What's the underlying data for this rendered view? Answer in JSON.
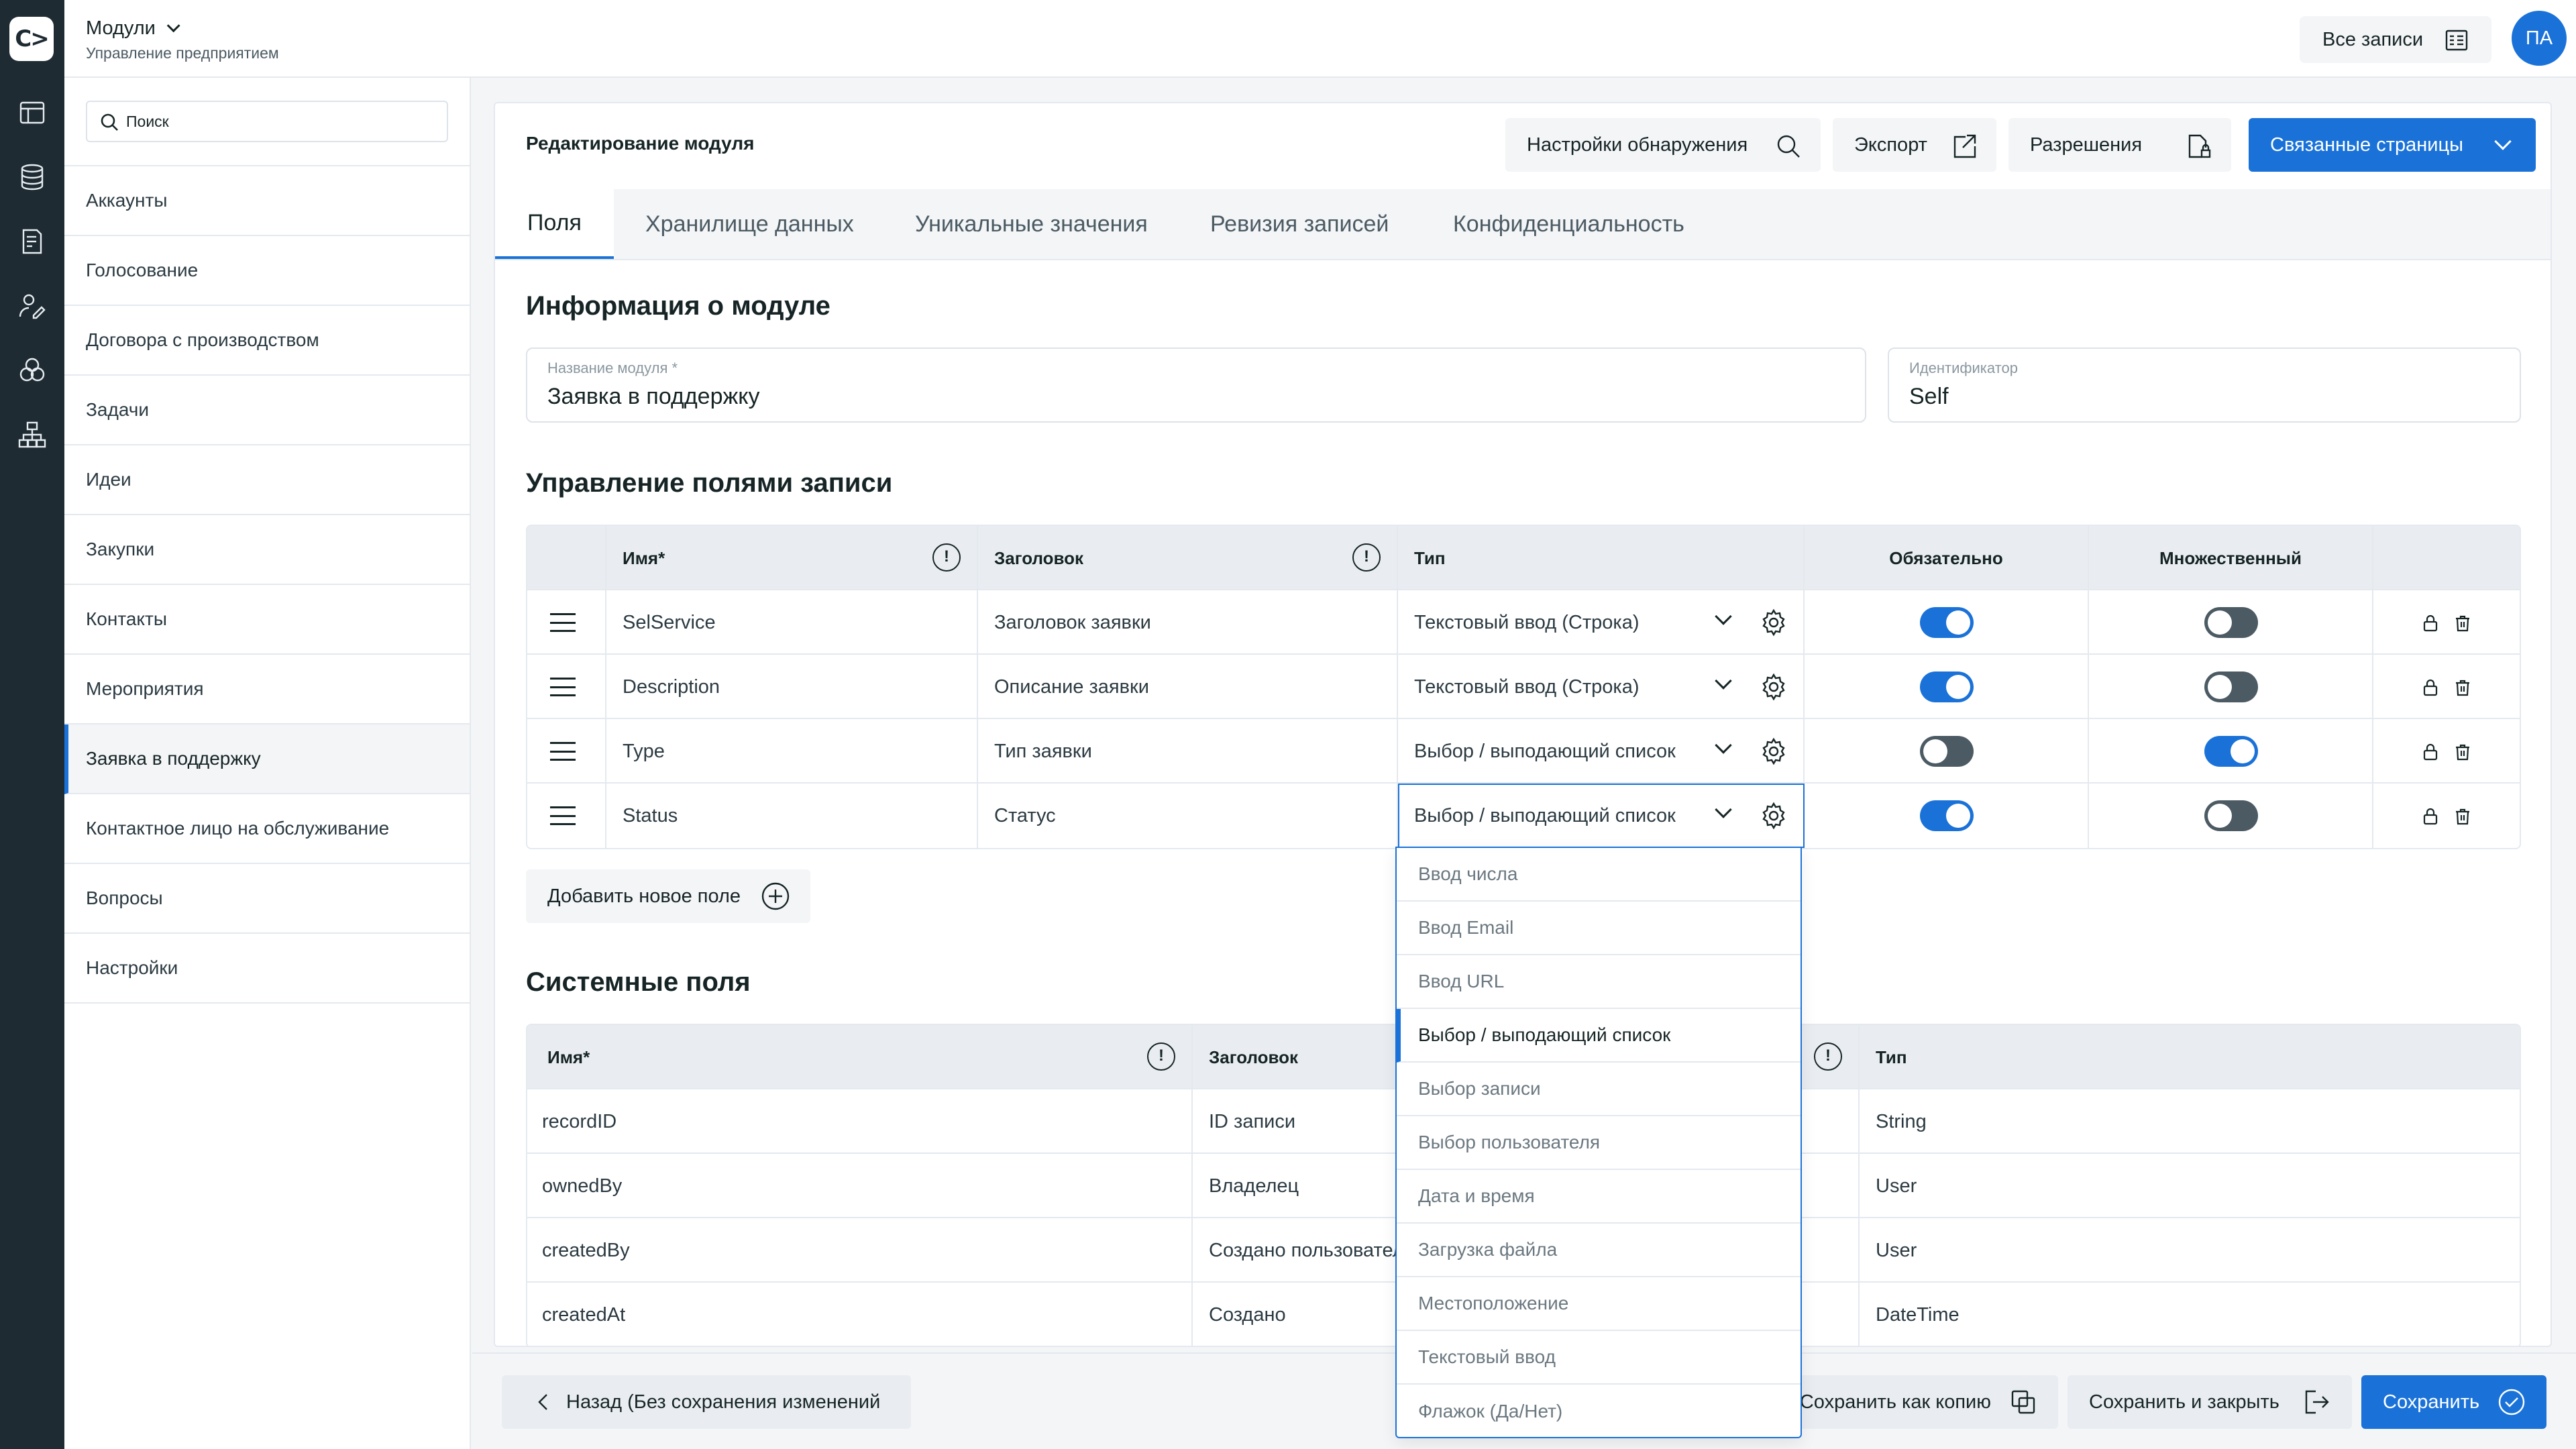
{
  "header": {
    "title": "Модули",
    "subtitle": "Управление предприятием",
    "all_records": "Все записи",
    "avatar": "ПА"
  },
  "sidebar": {
    "search_placeholder": "Поиск",
    "items": [
      {
        "label": "Аккаунты"
      },
      {
        "label": "Голосование"
      },
      {
        "label": "Договора с производством"
      },
      {
        "label": "Задачи"
      },
      {
        "label": "Идеи"
      },
      {
        "label": "Закупки"
      },
      {
        "label": "Контакты"
      },
      {
        "label": "Мероприятия"
      },
      {
        "label": "Заявка в поддержку",
        "active": true
      },
      {
        "label": "Контактное лицо на обслуживание"
      },
      {
        "label": "Вопросы"
      },
      {
        "label": "Настройки"
      }
    ]
  },
  "main": {
    "heading": "Редактирование модуля",
    "actions": {
      "discovery": "Настройки обнаружения",
      "export": "Экспорт",
      "permissions": "Разрешения",
      "related_pages": "Связанные страницы"
    },
    "tabs": [
      "Поля",
      "Хранилище данных",
      "Уникальные значения",
      "Ревизия записей",
      "Конфиденциальность"
    ],
    "module_info": {
      "title": "Информация о модуле",
      "name_label": "Название модуля *",
      "name_value": "Заявка в поддержку",
      "id_label": "Идентификатор",
      "id_value": "Self"
    },
    "fields": {
      "title": "Управление полями записи",
      "columns": {
        "name": "Имя*",
        "label": "Заголовок",
        "type": "Тип",
        "required": "Обязательно",
        "multiple": "Множественный"
      },
      "rows": [
        {
          "name": "SelService",
          "label": "Заголовок заявки",
          "type": "Текстовый ввод (Строка)",
          "required": true,
          "multiple": false
        },
        {
          "name": "Description",
          "label": "Описание заявки",
          "type": "Текстовый ввод (Строка)",
          "required": true,
          "multiple": false
        },
        {
          "name": "Type",
          "label": "Тип заявки",
          "type": "Выбор / выподающий список",
          "required": false,
          "multiple": true
        },
        {
          "name": "Status",
          "label": "Статус",
          "type": "Выбор / выподающий список",
          "required": true,
          "multiple": false
        }
      ],
      "add_button": "Добавить новое поле"
    },
    "type_dropdown": {
      "options": [
        "Ввод числа",
        "Ввод Email",
        "Ввод URL",
        "Выбор / выподающий список",
        "Выбор записи",
        "Выбор пользователя",
        "Дата и время",
        "Загрузка файла",
        "Местоположение",
        "Текстовый ввод",
        "Флажок (Да/Нет)"
      ],
      "selected": "Выбор / выподающий список"
    },
    "system_fields": {
      "title": "Системные поля",
      "columns": {
        "name": "Имя*",
        "label": "Заголовок",
        "type": "Тип"
      },
      "rows": [
        {
          "name": "recordID",
          "label": "ID записи",
          "type": "String"
        },
        {
          "name": "ownedBy",
          "label": "Владелец",
          "type": "User"
        },
        {
          "name": "createdBy",
          "label": "Создано пользователем",
          "type": "User"
        },
        {
          "name": "createdAt",
          "label": "Создано",
          "type": "DateTime"
        }
      ]
    }
  },
  "footer": {
    "back": "Назад (Без сохранения изменений",
    "save_copy": "Сохранить как копию",
    "save_close": "Сохранить и закрыть",
    "save": "Сохранить"
  },
  "colors": {
    "accent": "#1a72d8",
    "rail": "#1f2b33",
    "toggle_off": "#4b5a63"
  }
}
